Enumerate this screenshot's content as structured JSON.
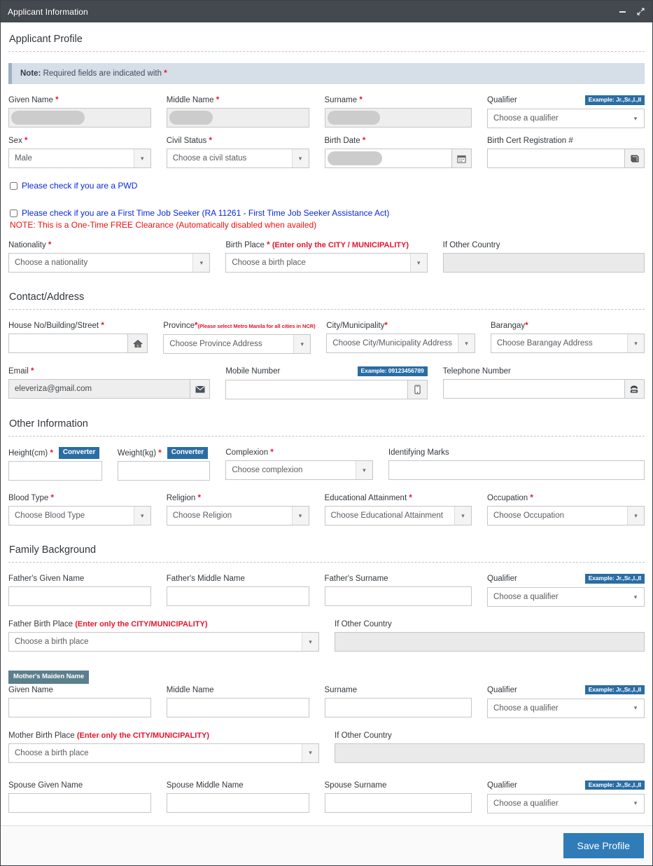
{
  "window": {
    "title": "Applicant Information",
    "minimize_icon": "minimize-icon",
    "restore_icon": "restore-icon"
  },
  "page": {
    "heading": "Applicant Profile",
    "note_prefix": "Note:",
    "note_text": "Required fields are indicated with",
    "required_mark": "*"
  },
  "labels": {
    "given_name": "Given Name",
    "middle_name": "Middle Name",
    "surname": "Surname",
    "qualifier": "Qualifier",
    "sex": "Sex",
    "civil_status": "Civil Status",
    "birth_date": "Birth Date",
    "birth_cert_reg": "Birth Cert Registration #",
    "nationality": "Nationality",
    "birth_place": "Birth Place",
    "birth_place_hint": "(Enter only the CITY / MUNICIPALITY)",
    "if_other_country": "If Other Country",
    "house_no": "House No/Building/Street",
    "province": "Province",
    "province_hint": "(Please select Metro Manila for all cities in NCR)",
    "city_municipality": "City/Municipality",
    "barangay": "Barangay",
    "email": "Email",
    "mobile_number": "Mobile Number",
    "telephone_number": "Telephone Number",
    "height": "Height(cm)",
    "weight": "Weight(kg)",
    "complexion": "Complexion",
    "identifying_marks": "Identifying Marks",
    "blood_type": "Blood Type",
    "religion": "Religion",
    "educational_attainment": "Educational Attainment",
    "occupation": "Occupation",
    "fathers_given_name": "Father's Given Name",
    "fathers_middle_name": "Father's Middle Name",
    "fathers_surname": "Father's Surname",
    "father_birth_place": "Father Birth Place",
    "father_birth_place_hint": "(Enter only the CITY/MUNICIPALITY)",
    "mother_given_name": "Given Name",
    "mother_middle_name": "Middle Name",
    "mother_surname": "Surname",
    "mother_birth_place": "Mother Birth Place",
    "mother_birth_place_hint": "(Enter only the CITY/MUNICIPALITY)",
    "spouse_given_name": "Spouse Given Name",
    "spouse_middle_name": "Spouse Middle Name",
    "spouse_surname": "Spouse Surname"
  },
  "sections": {
    "applicant_profile": "Applicant Profile",
    "contact_address": "Contact/Address",
    "other_information": "Other Information",
    "family_background": "Family Background"
  },
  "badges": {
    "qualifier_example": "Example: Jr.,Sr.,I.,II",
    "mobile_example": "Example: 09123456789",
    "mothers_maiden_name": "Mother's Maiden Name",
    "converter": "Converter"
  },
  "values": {
    "sex": "Male",
    "email": "eleveriza@gmail.com"
  },
  "placeholders": {
    "qualifier": "Choose a qualifier",
    "civil_status": "Choose a civil status",
    "nationality": "Choose a nationality",
    "birth_place": "Choose a birth place",
    "province": "Choose Province Address",
    "city_municipality": "Choose City/Municipality Address",
    "barangay": "Choose Barangay Address",
    "complexion": "Choose complexion",
    "blood_type": "Choose Blood Type",
    "religion": "Choose Religion",
    "educational_attainment": "Choose Educational Attainment",
    "occupation": "Choose Occupation",
    "empty": ""
  },
  "checkboxes": {
    "pwd": "Please check if you are a PWD",
    "first_time_job_seeker": "Please check if you are a First Time Job Seeker (RA 11261 - First Time Job Seeker Assistance Act)",
    "first_time_note": "NOTE: This is a One-Time FREE Clearance (Automatically disabled when availed)"
  },
  "footer": {
    "save_label": "Save Profile"
  },
  "colors": {
    "titlebar": "#44494f",
    "accent_blue": "#2f7cb8",
    "badge_blue": "#2a6da4",
    "badge_teal": "#5b7f8c",
    "required_red": "#e8132b",
    "link_blue": "#0a28d8",
    "note_red": "#ee1111",
    "note_bar_bg": "#d6dee8"
  }
}
